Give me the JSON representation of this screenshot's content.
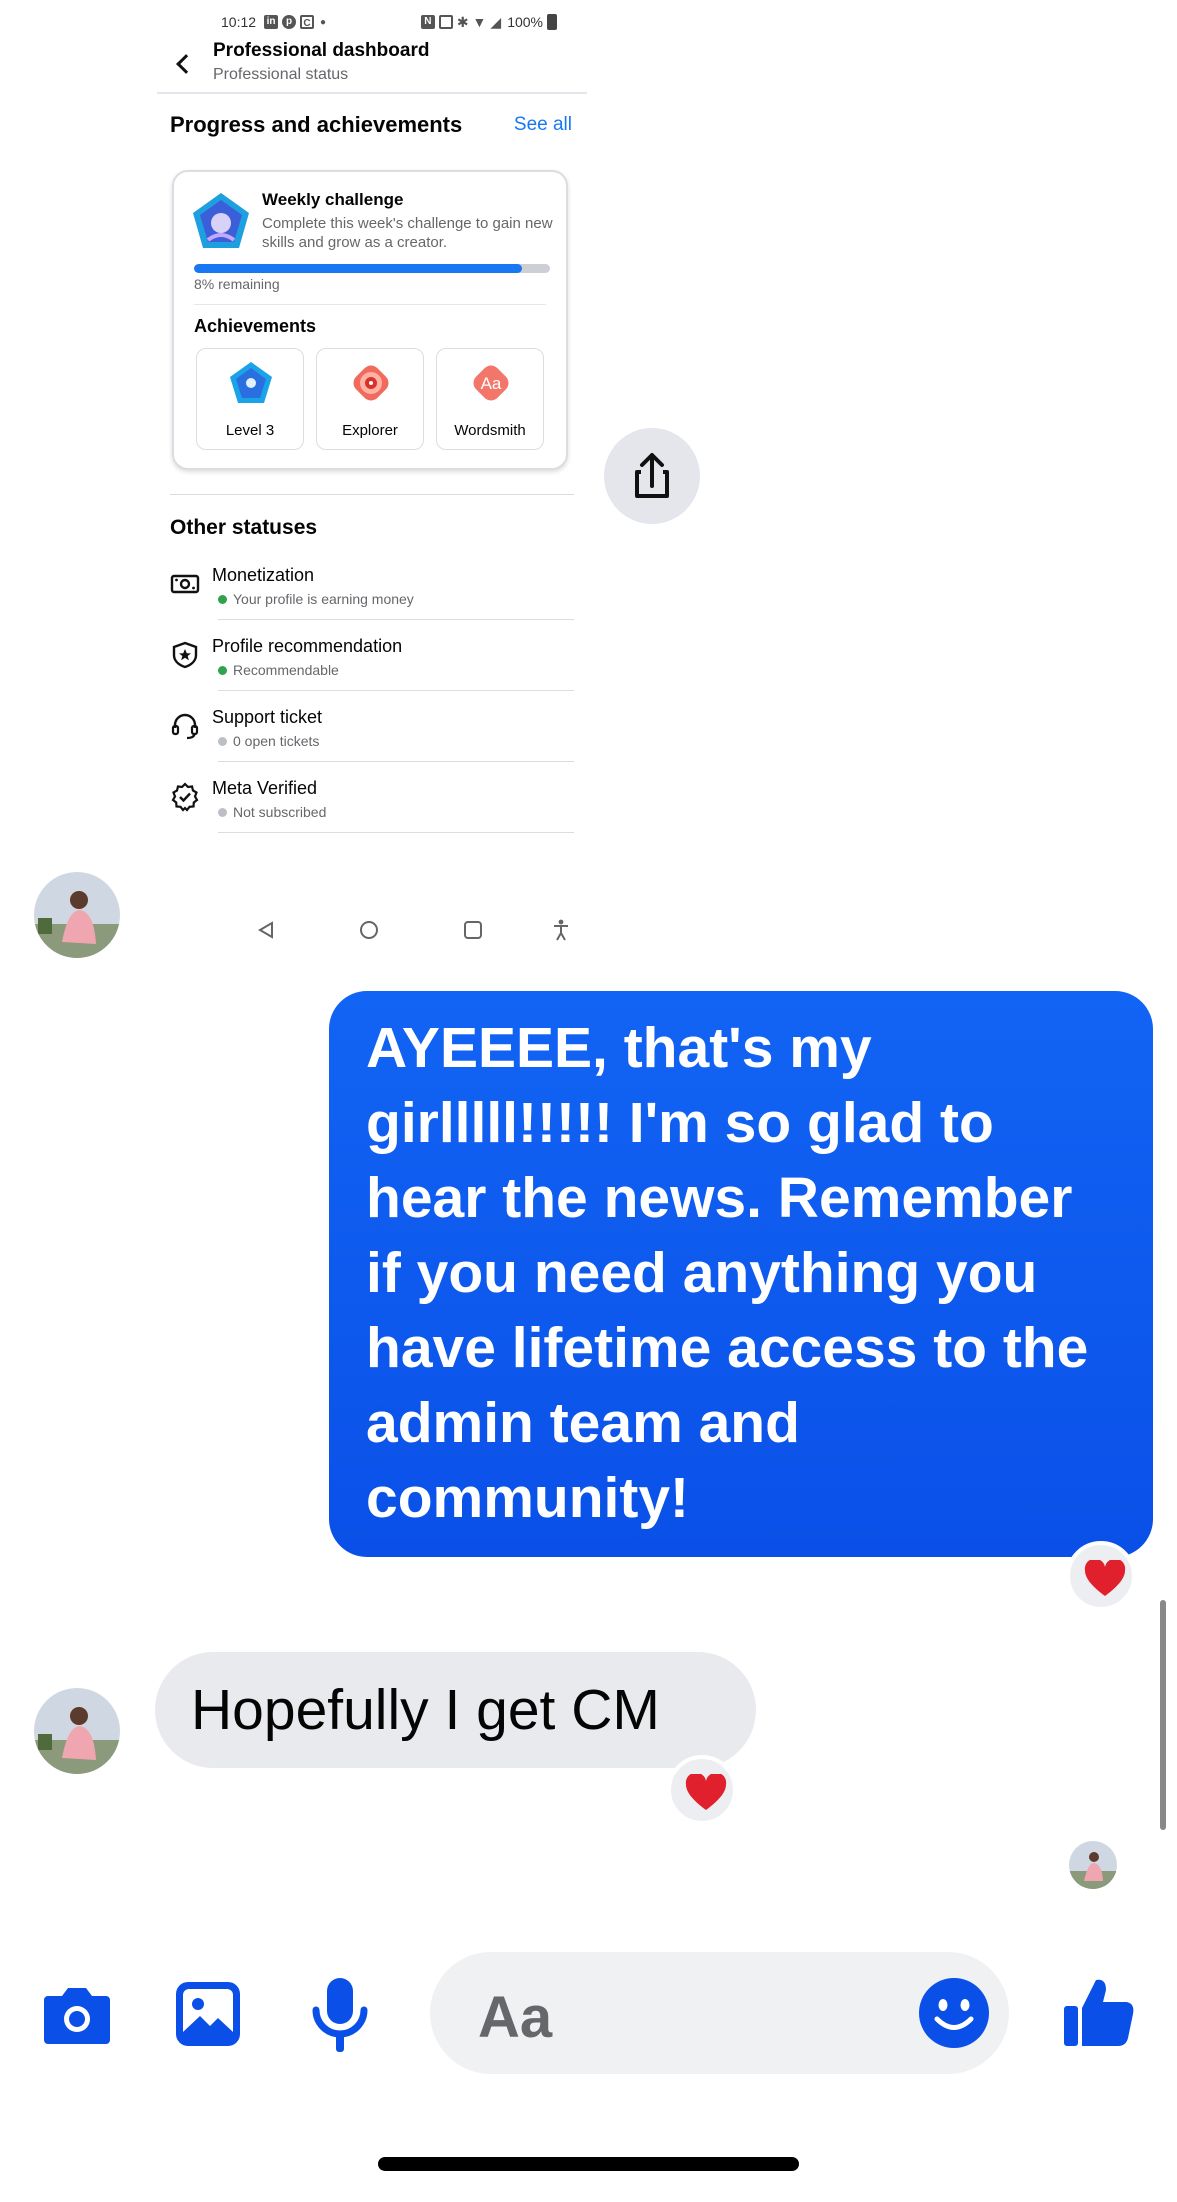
{
  "screenshot": {
    "status_bar": {
      "time": "10:12",
      "battery": "100%"
    },
    "header": {
      "title": "Professional dashboard",
      "subtitle": "Professional status"
    },
    "progress_section": {
      "title": "Progress and achievements",
      "see_all": "See all",
      "weekly_challenge": {
        "title": "Weekly challenge",
        "description": "Complete this week's challenge to gain new skills and grow as a creator.",
        "progress_fraction": 0.92,
        "remaining": "8% remaining"
      },
      "achievements_title": "Achievements",
      "achievements": [
        {
          "label": "Level 3",
          "icon": "level-badge-icon"
        },
        {
          "label": "Explorer",
          "icon": "explorer-badge-icon"
        },
        {
          "label": "Wordsmith",
          "icon": "wordsmith-badge-icon"
        }
      ],
      "wordsmith_glyph": "Aa"
    },
    "other_statuses": {
      "title": "Other statuses",
      "items": [
        {
          "name": "Monetization",
          "status": "Your profile is earning money",
          "dot_color": "#31a24c",
          "icon": "money-icon"
        },
        {
          "name": "Profile recommendation",
          "status": "Recommendable",
          "dot_color": "#31a24c",
          "icon": "shield-star-icon"
        },
        {
          "name": "Support ticket",
          "status": "0 open tickets",
          "dot_color": "#bcc0c4",
          "icon": "headset-icon"
        },
        {
          "name": "Meta Verified",
          "status": "Not subscribed",
          "dot_color": "#bcc0c4",
          "icon": "verified-badge-icon"
        }
      ]
    }
  },
  "chat": {
    "outgoing_message": "AYEEEE, that's my girlllll!!!!! I'm so glad to hear the news. Remember if you need anything you have lifetime access to the admin team and community!",
    "outgoing_reaction": "heart",
    "incoming_message": "Hopefully I get CM",
    "incoming_reaction": "heart"
  },
  "composer": {
    "placeholder": "Aa",
    "accent_color": "#0a50e8"
  }
}
